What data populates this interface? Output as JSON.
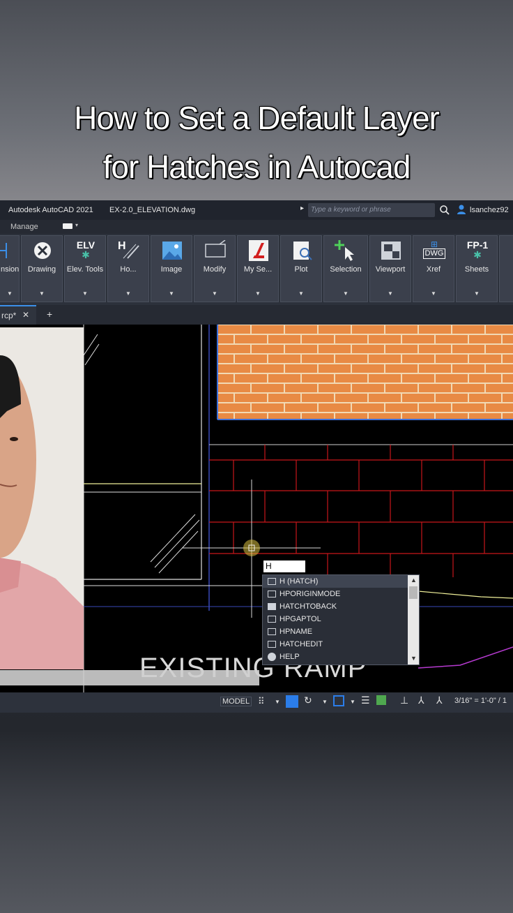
{
  "headline": {
    "line1": "How to Set a Default Layer",
    "line2": "for Hatches in Autocad"
  },
  "titlebar": {
    "app_title": "Autodesk AutoCAD 2021",
    "file_name": "EX-2.0_ELEVATION.dwg",
    "search_placeholder": "Type a keyword or phrase",
    "user": "lsanchez92"
  },
  "menubar": {
    "tab": "Manage"
  },
  "ribbon": {
    "buttons": [
      {
        "label": "nsion",
        "icon": "dimension-icon"
      },
      {
        "label": "Drawing",
        "icon": "close-circle-icon"
      },
      {
        "label": "Elev. Tools",
        "icon_text": "ELV",
        "icon": "elevation-tools-icon"
      },
      {
        "label": "Ho...",
        "icon_text": "H",
        "icon": "hatch-tools-icon"
      },
      {
        "label": "Image",
        "icon": "image-icon"
      },
      {
        "label": "Modify",
        "icon": "modify-icon"
      },
      {
        "label": "My Se...",
        "icon": "my-settings-icon"
      },
      {
        "label": "Plot",
        "icon": "plot-icon"
      },
      {
        "label": "Selection",
        "icon": "selection-icon"
      },
      {
        "label": "Viewport",
        "icon": "viewport-icon"
      },
      {
        "label": "Xref",
        "icon_text": "DWG",
        "icon": "xref-icon"
      },
      {
        "label": "Sheets",
        "icon_text": "FP-1",
        "icon": "sheets-icon"
      }
    ]
  },
  "tabs": {
    "file_tab": "rcp*",
    "close": "✕",
    "add": "+"
  },
  "command": {
    "input_value": "H",
    "suggestions": [
      "H (HATCH)",
      "HPORIGINMODE",
      "HATCHTOBACK",
      "HPGAPTOL",
      "HPNAME",
      "HATCHEDIT",
      "HELP"
    ]
  },
  "drawing": {
    "label": "EXISTING RAMP"
  },
  "statusbar": {
    "model": "MODEL",
    "scale": "3/16\" = 1'-0\" / 1"
  },
  "colors": {
    "brick_fill": "#e88a44",
    "brick_mortar": "#f1d9b4",
    "red_lines": "#c8161b",
    "ribbon_bg": "#2c313b",
    "accent_blue": "#2b7de9"
  }
}
